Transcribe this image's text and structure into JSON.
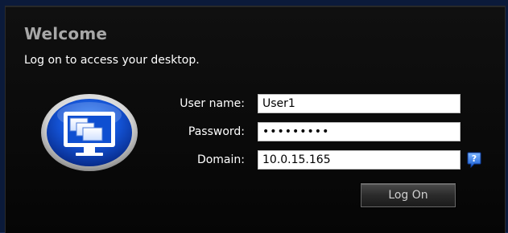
{
  "header": {
    "title": "Welcome",
    "subtitle": "Log on to access your desktop."
  },
  "logo": {
    "icon": "remote-desktop-monitor-icon"
  },
  "form": {
    "username": {
      "label": "User name:",
      "value": "User1"
    },
    "password": {
      "label": "Password:",
      "value": "•••••••••"
    },
    "domain": {
      "label": "Domain:",
      "value": "10.0.15.165",
      "help_icon": "help-question-icon"
    },
    "submit_label": "Log On"
  },
  "colors": {
    "panel_background": "#0a0a0a",
    "title": "#a7a7a7",
    "text": "#ffffff",
    "accent_blue": "#1f5bd6"
  }
}
